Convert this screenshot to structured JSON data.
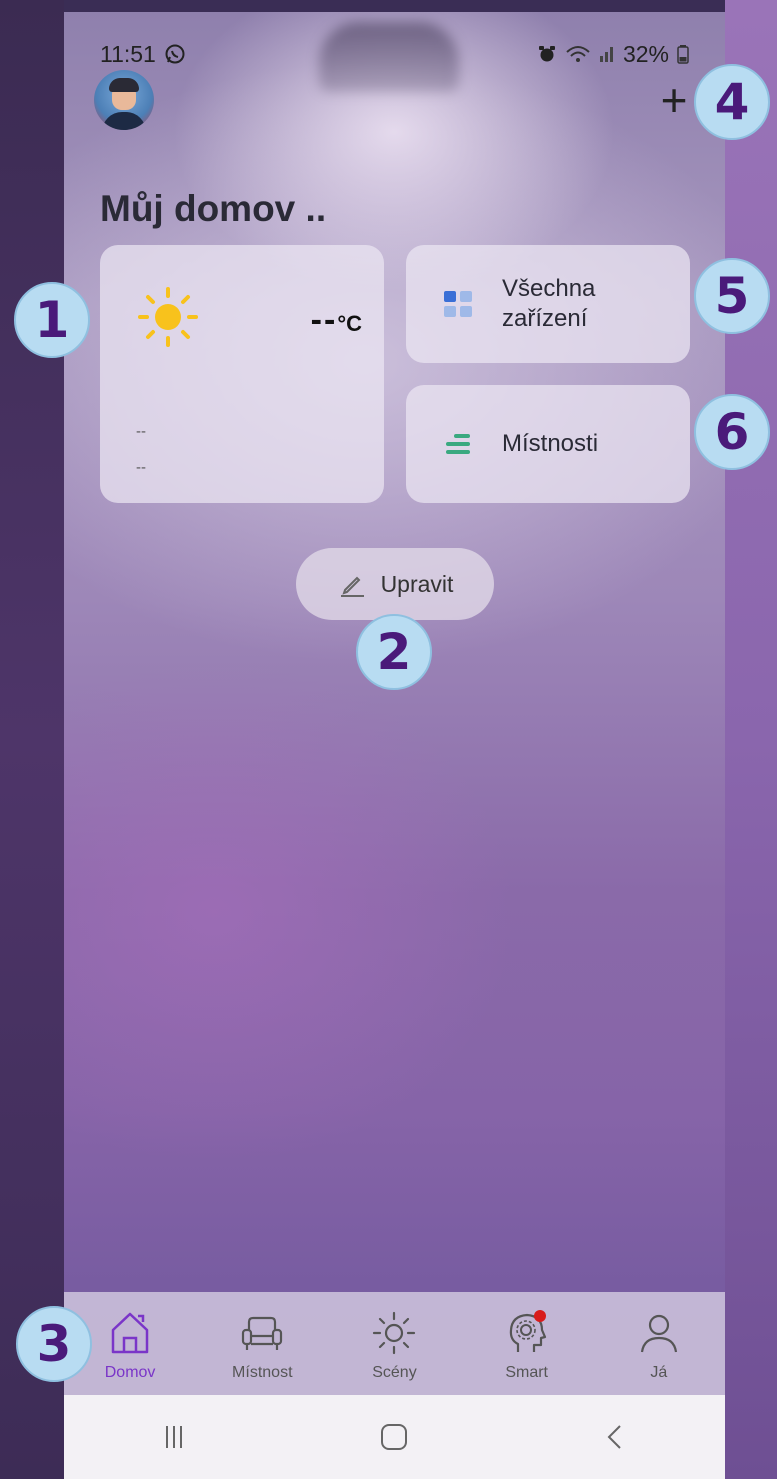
{
  "status_bar": {
    "time": "11:51",
    "battery": "32%"
  },
  "header": {
    "title": "Můj domov .."
  },
  "weather": {
    "temperature": "--",
    "unit": "°C",
    "line1": "--",
    "line2": "--"
  },
  "tiles": {
    "all_devices_line1": "Všechna",
    "all_devices_line2": "zařízení",
    "rooms": "Místnosti"
  },
  "edit_button": {
    "label": "Upravit"
  },
  "bottom_nav": {
    "items": [
      {
        "label": "Domov",
        "icon": "home-icon",
        "active": true
      },
      {
        "label": "Místnost",
        "icon": "armchair-icon",
        "active": false
      },
      {
        "label": "Scény",
        "icon": "sun-scene-icon",
        "active": false
      },
      {
        "label": "Smart",
        "icon": "smart-head-icon",
        "active": false
      },
      {
        "label": "Já",
        "icon": "person-icon",
        "active": false
      }
    ]
  },
  "callouts": [
    "1",
    "2",
    "3",
    "4",
    "5",
    "6"
  ],
  "colors": {
    "accent": "#7a35c8",
    "badge_bg": "#b8dcf2",
    "badge_text": "#4a1a7a"
  }
}
